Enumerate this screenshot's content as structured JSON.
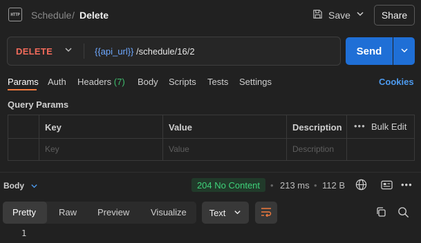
{
  "header": {
    "icon_text": "HTTP",
    "collection": "Schedule",
    "separator": "/",
    "request_name": "Delete",
    "save_label": "Save",
    "share_label": "Share"
  },
  "request": {
    "method": "DELETE",
    "url_variable": "{{api_url}}",
    "url_path": "/schedule/16/2",
    "send_label": "Send",
    "method_color": "#f26b5b",
    "variable_color": "#6ea8ff",
    "send_color": "#1f6fd6"
  },
  "tabs": {
    "params": "Params",
    "auth": "Auth",
    "headers": "Headers",
    "headers_count": "(7)",
    "body": "Body",
    "scripts": "Scripts",
    "tests": "Tests",
    "settings": "Settings",
    "cookies": "Cookies",
    "active": "Params",
    "accent_color": "#f27a3e"
  },
  "query_params": {
    "title": "Query Params",
    "columns": [
      "Key",
      "Value",
      "Description"
    ],
    "bulk_edit": "Bulk Edit",
    "placeholders": {
      "key": "Key",
      "value": "Value",
      "description": "Description"
    }
  },
  "response": {
    "body_label": "Body",
    "status": "204 No Content",
    "status_color": "#3fd27a",
    "time": "213 ms",
    "size": "112 B",
    "views": [
      "Pretty",
      "Raw",
      "Preview",
      "Visualize"
    ],
    "active_view": "Pretty",
    "format": "Text",
    "line_number": "1"
  }
}
